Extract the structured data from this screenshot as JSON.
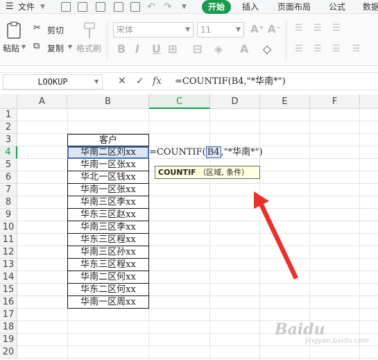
{
  "menu": {
    "file": "文件",
    "tabs": [
      "开始",
      "插入",
      "页面布局",
      "公式",
      "数据"
    ]
  },
  "ribbon": {
    "paste": "粘贴",
    "cut": "剪切",
    "copy": "复制",
    "format_painter": "格式刷",
    "font_name": "宋体",
    "font_size": "11"
  },
  "formula_bar": {
    "name_box": "LOOKUP",
    "cancel": "✕",
    "confirm": "✓",
    "fx": "fx",
    "formula": "=COUNTIF(B4,\"*华南*\")"
  },
  "columns": [
    "A",
    "B",
    "C",
    "D",
    "E",
    "F"
  ],
  "active_column": "C",
  "rows": [
    "1",
    "2",
    "3",
    "4",
    "5",
    "6",
    "7",
    "8",
    "9",
    "10",
    "11",
    "12",
    "13",
    "14",
    "15",
    "16",
    "17",
    "18",
    "19",
    "20"
  ],
  "active_row": "4",
  "table": {
    "header": "客户",
    "values": [
      "华南二区刘xx",
      "华南一区张xx",
      "华北一区钱xx",
      "华南一区张xx",
      "华南三区李xx",
      "华东三区赵xx",
      "华南三区李xx",
      "华东三区程xx",
      "华南三区孙xx",
      "华东三区程xx",
      "华南二区何xx",
      "华东二区何xx",
      "华南一区周xx"
    ]
  },
  "editing": {
    "prefix": "=COUNTIF(",
    "ref": "B4",
    "suffix": ",\"*华南*\")"
  },
  "tooltip": {
    "func": "COUNTIF",
    "args": "（区域, 条件）"
  },
  "watermark": "Baidu",
  "watermark_sub": "jingyan.baidu.com",
  "colors": {
    "accent": "#1a9a4d",
    "arrow": "#e8322b",
    "selection": "#3f6fb5"
  }
}
